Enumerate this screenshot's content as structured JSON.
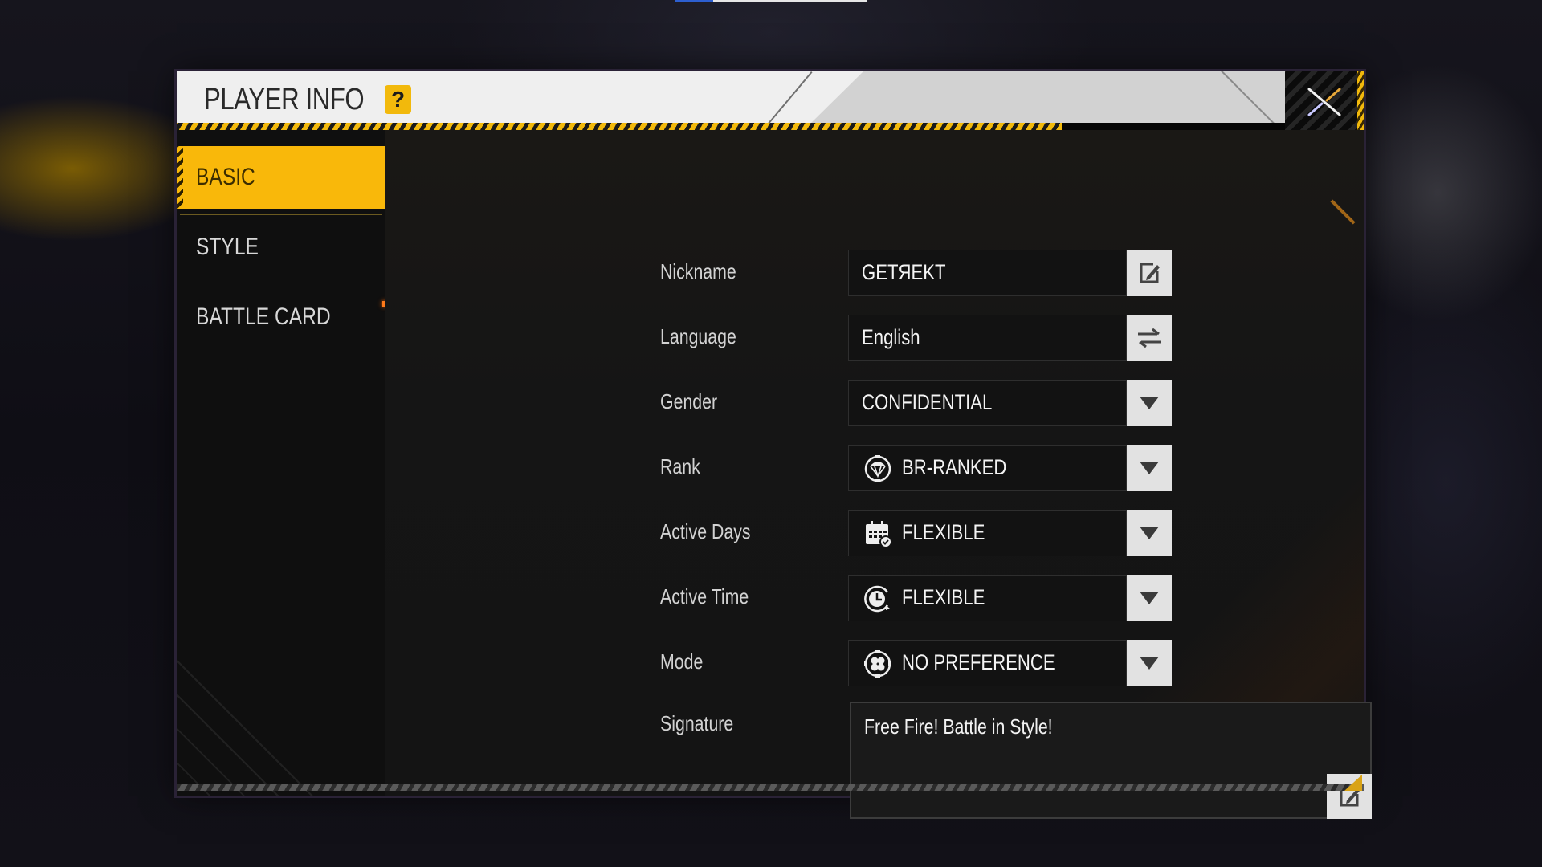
{
  "video": {
    "progress": 0.2
  },
  "dialog": {
    "title": "PLAYER INFO",
    "help_label": "?",
    "close_icon": "close-x-icon"
  },
  "sidebar": {
    "tabs": [
      {
        "label": "BASIC",
        "active": true
      },
      {
        "label": "STYLE",
        "active": false
      },
      {
        "label": "BATTLE CARD",
        "active": false,
        "notification": true
      }
    ]
  },
  "form": {
    "nickname": {
      "label": "Nickname",
      "value": "GETЯEKT",
      "button_icon": "edit-icon"
    },
    "language": {
      "label": "Language",
      "value": "English",
      "button_icon": "swap-arrows-icon"
    },
    "gender": {
      "label": "Gender",
      "value": "CONFIDENTIAL",
      "button_icon": "dropdown-triangle-icon"
    },
    "rank": {
      "label": "Rank",
      "value": "BR-RANKED",
      "value_icon": "parachute-icon",
      "button_icon": "dropdown-triangle-icon"
    },
    "active_days": {
      "label": "Active Days",
      "value": "FLEXIBLE",
      "value_icon": "calendar-check-icon",
      "button_icon": "dropdown-triangle-icon"
    },
    "active_time": {
      "label": "Active Time",
      "value": "FLEXIBLE",
      "value_icon": "clock-icon",
      "button_icon": "dropdown-triangle-icon"
    },
    "mode": {
      "label": "Mode",
      "value": "NO PREFERENCE",
      "value_icon": "mode-grid-icon",
      "button_icon": "dropdown-triangle-icon"
    },
    "signature": {
      "label": "Signature",
      "value": "Free Fire! Battle in Style!",
      "button_icon": "edit-icon"
    }
  },
  "colors": {
    "accent": "#f9b80a",
    "notification": "#ff7a1a",
    "panel": "#141414"
  }
}
